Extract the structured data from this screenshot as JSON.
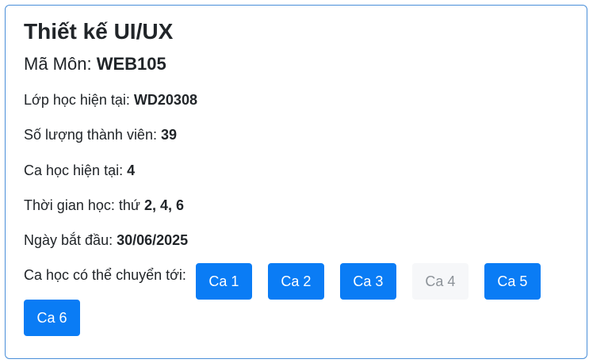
{
  "course": {
    "title": "Thiết kế UI/UX",
    "code_label": "Mã Môn:",
    "code_value": "WEB105"
  },
  "info": {
    "class_label": "Lớp học hiện tại:",
    "class_value": "WD20308",
    "members_label": "Số lượng thành viên:",
    "members_value": "39",
    "shift_label": "Ca học hiện tại:",
    "shift_value": "4",
    "schedule_label": "Thời gian học: thứ",
    "schedule_value": "2, 4, 6",
    "start_label": "Ngày bắt đầu:",
    "start_value": "30/06/2025"
  },
  "transfer": {
    "label": "Ca học có thể chuyển tới:",
    "shifts": [
      {
        "label": "Ca 1",
        "enabled": true
      },
      {
        "label": "Ca 2",
        "enabled": true
      },
      {
        "label": "Ca 3",
        "enabled": true
      },
      {
        "label": "Ca 4",
        "enabled": false
      },
      {
        "label": "Ca 5",
        "enabled": true
      },
      {
        "label": "Ca 6",
        "enabled": true
      }
    ]
  },
  "colors": {
    "accent": "#0a7cf5",
    "border": "#4a8fd9",
    "disabled_bg": "#f6f7f9",
    "disabled_text": "#8d9399"
  }
}
